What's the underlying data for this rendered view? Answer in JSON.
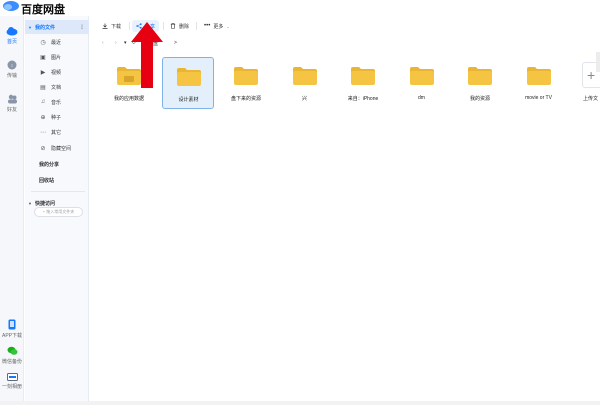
{
  "app": {
    "title": "百度网盘"
  },
  "rail": [
    {
      "label": "首页",
      "icon": "cloud-icon"
    },
    {
      "label": "传输",
      "icon": "transfer-icon"
    },
    {
      "label": "好友",
      "icon": "friends-icon"
    },
    {
      "label": "APP下载",
      "icon": "phone-icon"
    },
    {
      "label": "微信备份",
      "icon": "wechat-icon"
    },
    {
      "label": "一刻相册",
      "icon": "album-icon"
    }
  ],
  "sidebar": {
    "my_files": "我的文件",
    "items": [
      {
        "label": "最近",
        "icon": "◷"
      },
      {
        "label": "图片",
        "icon": "▣"
      },
      {
        "label": "视频",
        "icon": "▶"
      },
      {
        "label": "文档",
        "icon": "▤"
      },
      {
        "label": "音乐",
        "icon": "♫"
      },
      {
        "label": "种子",
        "icon": "⊕"
      },
      {
        "label": "其它",
        "icon": "⋯"
      },
      {
        "label": "隐藏空间",
        "icon": "⊘"
      }
    ],
    "my_share": "我的分享",
    "recycle_bin": "回收站",
    "quick_access": "快捷访问",
    "quick_add": "+ 拖入常用文件夹"
  },
  "toolbar": {
    "download": "下载",
    "share": "分享",
    "delete": "删除",
    "more": "更多"
  },
  "breadcrumb": {
    "current": "网盘",
    "separator": ">"
  },
  "folders": [
    {
      "name": "我的应用数据",
      "selected": false,
      "badge": true
    },
    {
      "name": "设计素材",
      "selected": true,
      "badge": false
    },
    {
      "name": "盘下来的资源",
      "selected": false,
      "badge": false
    },
    {
      "name": "兴",
      "selected": false,
      "badge": false
    },
    {
      "name": "来自：iPhone",
      "selected": false,
      "badge": false
    },
    {
      "name": "dm",
      "selected": false,
      "badge": false
    },
    {
      "name": "我的资源",
      "selected": false,
      "badge": false
    },
    {
      "name": "movie or TV",
      "selected": false,
      "badge": false
    }
  ],
  "upload": {
    "label": "上传文"
  },
  "colors": {
    "accent": "#1677ff",
    "folder": "#f6c443",
    "folder_tab": "#eab533",
    "arrow": "#e60012"
  }
}
